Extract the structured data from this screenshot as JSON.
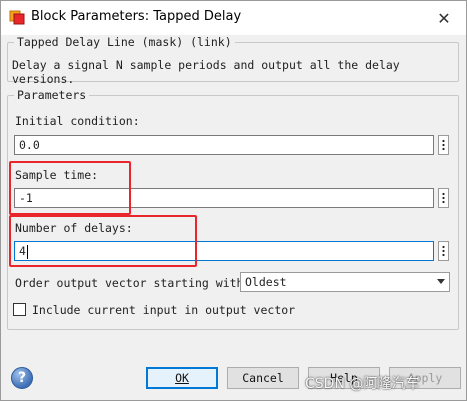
{
  "window": {
    "title": "Block Parameters: Tapped Delay",
    "close_glyph": "✕",
    "accent_color": "#0078d7",
    "highlight_color": "#e8262b"
  },
  "mask": {
    "legend": "Tapped Delay Line (mask) (link)",
    "description": "Delay a signal N sample periods and output all the delay versions."
  },
  "parameters": {
    "legend": "Parameters",
    "initial_condition": {
      "label": "Initial condition:",
      "value": "0.0"
    },
    "sample_time": {
      "label": "Sample time:",
      "value": "-1"
    },
    "number_of_delays": {
      "label": "Number of delays:",
      "value": "4"
    },
    "order_output": {
      "label": "Order output vector starting with:",
      "selected": "Oldest"
    },
    "include_current": {
      "label": "Include current input in output vector",
      "checked": false
    }
  },
  "buttons": {
    "ok": "OK",
    "cancel": "Cancel",
    "help": "Help",
    "apply": "Apply"
  },
  "watermark": "CSDN @阿隆汽车"
}
